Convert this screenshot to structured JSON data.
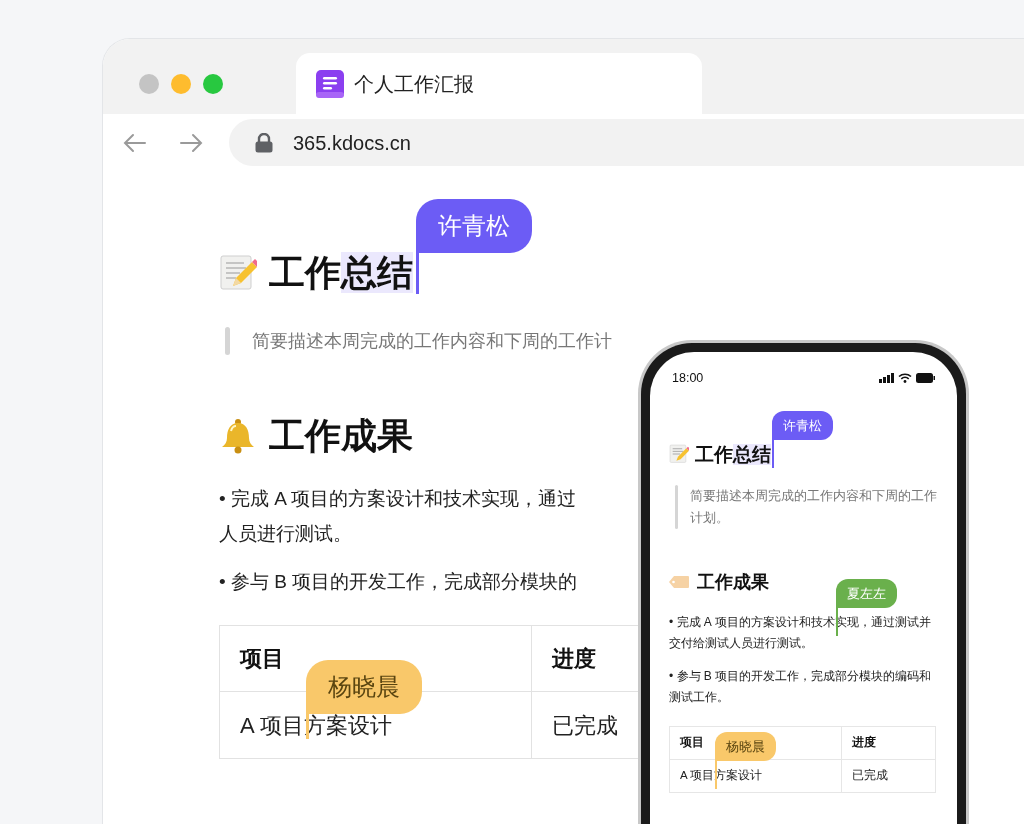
{
  "browser": {
    "tab": {
      "title": "个人工作汇报"
    },
    "url": "365.kdocs.cn",
    "document": {
      "title": [
        {
          "text": "工作"
        },
        {
          "text": "总结",
          "highlighted": true,
          "cursor": {
            "name": "许青松",
            "color": "#6c5cf5"
          }
        }
      ],
      "summary": "简要描述本周完成的工作内容和下周的工作计",
      "section": "工作成果",
      "bullets": [
        {
          "lines": [
            "• 完成 A 项目的方案设计和技术实现，通过",
            "人员进行测试。"
          ]
        },
        {
          "lines": [
            "• 参与 B 项目的开发工作，完成部分模块的"
          ]
        }
      ],
      "table": {
        "columns": [
          "项目",
          "进度"
        ],
        "rows": [
          [
            [
              {
                "text": "A 项目",
                "cursor": {
                  "name": "杨晓晨",
                  "color": "#f9c86a"
                }
              },
              {
                "text": "方案设计"
              }
            ],
            [
              {
                "text": "已完成"
              }
            ]
          ]
        ]
      }
    }
  },
  "phone": {
    "time": "18:00",
    "document": {
      "title": [
        {
          "text": "工作"
        },
        {
          "text": "总结",
          "highlighted": true,
          "cursor": {
            "name": "许青松",
            "color": "#6c5cf5"
          }
        }
      ],
      "summary": "简要描述本周完成的工作内容和下周的工作计划。",
      "section": "工作成果",
      "bullets": [
        [
          {
            "text": "• 完成 A 项目的方案设计和技术",
            "cursor": {
              "name": "夏左左",
              "color": "#6ab04c"
            }
          },
          {
            "text": "实现，通过测试并交付给测试人员进行测试。"
          }
        ],
        [
          {
            "text": "• 参与 B 项目的开发工作，完成部分模块的编码和测试工作。"
          }
        ]
      ],
      "table": {
        "columns": [
          "项目",
          "进度"
        ],
        "rows": [
          [
            [
              {
                "text": "A 项目",
                "cursor": {
                  "name": "杨晓晨",
                  "color": "#f9c86a"
                }
              },
              {
                "text": "方案设计"
              }
            ],
            [
              {
                "text": "已完成"
              }
            ]
          ]
        ]
      }
    }
  }
}
